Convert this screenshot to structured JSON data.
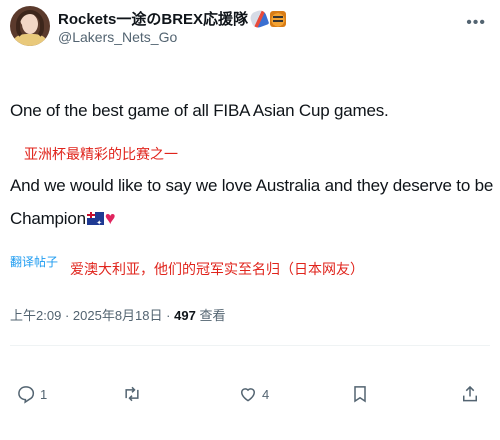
{
  "header": {
    "name": "Rockets一途のBREX応援隊",
    "handle": "@Lakers_Nets_Go",
    "name_emojis": [
      "rocket-icon",
      "tiger-icon"
    ]
  },
  "post": {
    "line1": "One of the best game of all FIBA Asian Cup games.",
    "cn1": "亚洲杯最精彩的比赛之一",
    "line2": "And we would like to say we love Australia and they deserve to be",
    "line3": "Champion",
    "translate_label": "翻译帖子",
    "cn2": "爱澳大利亚，他们的冠军实至名归（日本网友）"
  },
  "meta": {
    "time": "上午2:09",
    "date": "2025年8月18日",
    "views_count": "497",
    "views_label": "查看",
    "sep": "·"
  },
  "actions": {
    "reply_count": "1",
    "like_count": "4"
  },
  "colors": {
    "text": "#0f1419",
    "secondary": "#536471",
    "link": "#1d9bf0",
    "annotation_red": "#e0241c"
  }
}
